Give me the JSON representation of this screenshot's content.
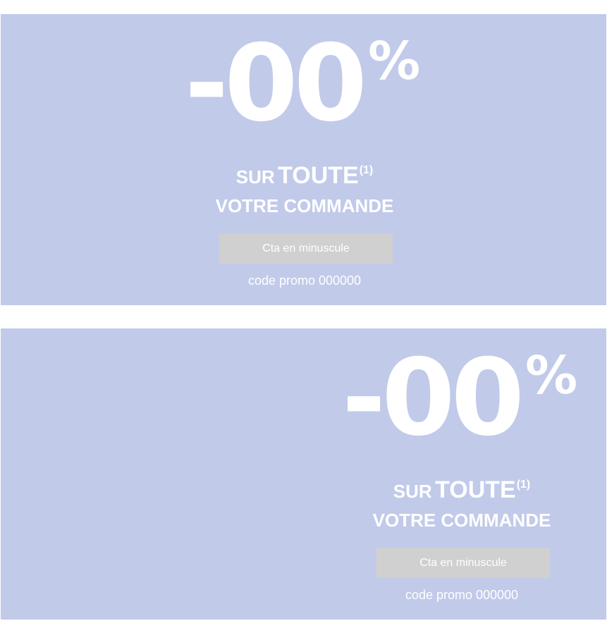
{
  "banners": [
    {
      "discount": "-00",
      "percent_sign": "%",
      "line1_small": "SUR",
      "line1_big": "TOUTE",
      "footnote_marker": "(1)",
      "line2": "VOTRE COMMANDE",
      "cta_label": "Cta en minuscule",
      "promo_text": "code promo 000000"
    },
    {
      "discount": "-00",
      "percent_sign": "%",
      "line1_small": "SUR",
      "line1_big": "TOUTE",
      "footnote_marker": "(1)",
      "line2": "VOTRE COMMANDE",
      "cta_label": "Cta en minuscule",
      "promo_text": "code promo 000000"
    }
  ],
  "colors": {
    "banner_background": "#c1cae9",
    "text": "#ffffff",
    "cta_background": "#d0d0d0",
    "page_background": "#ffffff"
  }
}
